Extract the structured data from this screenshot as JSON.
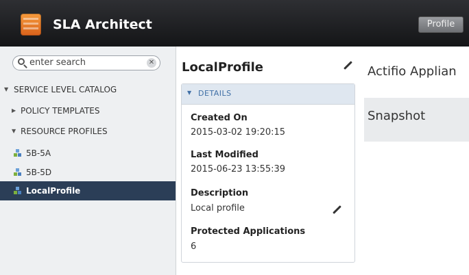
{
  "header": {
    "app_title": "SLA Architect",
    "profile_button": "Profile",
    "logo_icon": "sla-architect-logo-icon"
  },
  "sidebar": {
    "search": {
      "placeholder": "enter search",
      "value": ""
    },
    "tree": [
      {
        "label": "SERVICE LEVEL CATALOG",
        "expanded": true
      },
      {
        "label": "POLICY TEMPLATES",
        "expanded": false
      },
      {
        "label": "RESOURCE PROFILES",
        "expanded": true
      },
      {
        "label": "5B-5A"
      },
      {
        "label": "5B-5D"
      },
      {
        "label": "LocalProfile",
        "selected": true
      }
    ]
  },
  "details": {
    "title": "LocalProfile",
    "section_label": "DETAILS",
    "created_on_label": "Created On",
    "created_on_value": "2015-03-02 19:20:15",
    "last_modified_label": "Last Modified",
    "last_modified_value": "2015-06-23 13:55:39",
    "description_label": "Description",
    "description_value": "Local profile",
    "protected_apps_label": "Protected Applications",
    "protected_apps_value": "6"
  },
  "right_panel": {
    "title": "Actifio Applian",
    "snapshot_label": "Snapshot"
  },
  "colors": {
    "topbar": "#1f2023",
    "selected_row": "#2b3e57",
    "details_header": "#dfe7f0",
    "accent_blue": "#3f6fa6"
  }
}
